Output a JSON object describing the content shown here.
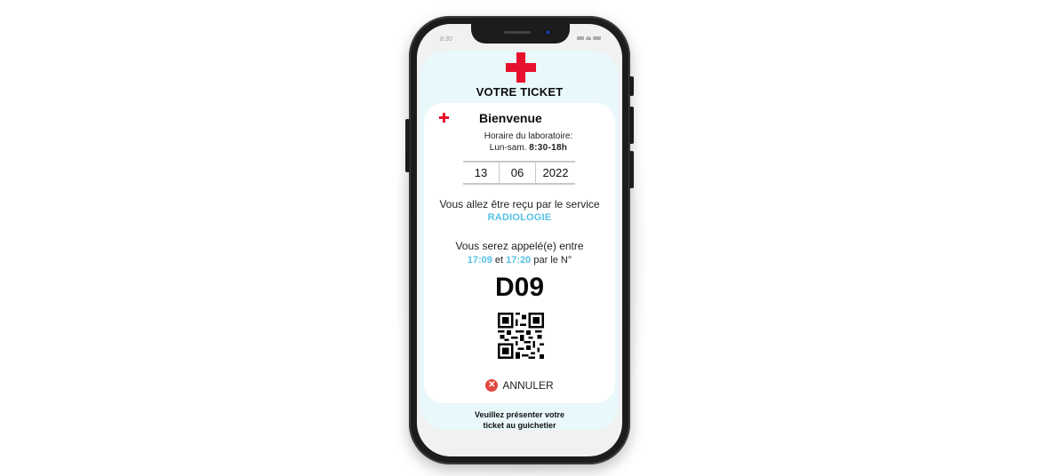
{
  "status_bar": {
    "time": "8:30"
  },
  "ticket": {
    "title": "VOTRE TICKET",
    "welcome": "Bienvenue",
    "hours_label": "Horaire du laboratoire:",
    "hours_days": "Lun-sam.",
    "hours_time": "8:30-18h",
    "date": {
      "day": "13",
      "month": "06",
      "year": "2022"
    },
    "service_intro": "Vous allez être reçu par le service",
    "service_name": "RADIOLOGIE",
    "call_intro": "Vous serez appelé(e) entre",
    "call_start": "17:09",
    "call_and": "et",
    "call_end": "17:20",
    "call_suffix": "par le N°",
    "number": "D09",
    "cancel_label": "ANNULER",
    "footer_line1": "Veuillez présenter votre",
    "footer_line2": "ticket au guichetier"
  },
  "colors": {
    "accent_red": "#e8112d",
    "accent_blue": "#55c2e6",
    "ticket_bg": "#e9f8fb"
  },
  "icons": [
    "red-cross-icon",
    "qr-code-icon",
    "cancel-icon",
    "signal-icon",
    "wifi-icon",
    "battery-icon"
  ]
}
